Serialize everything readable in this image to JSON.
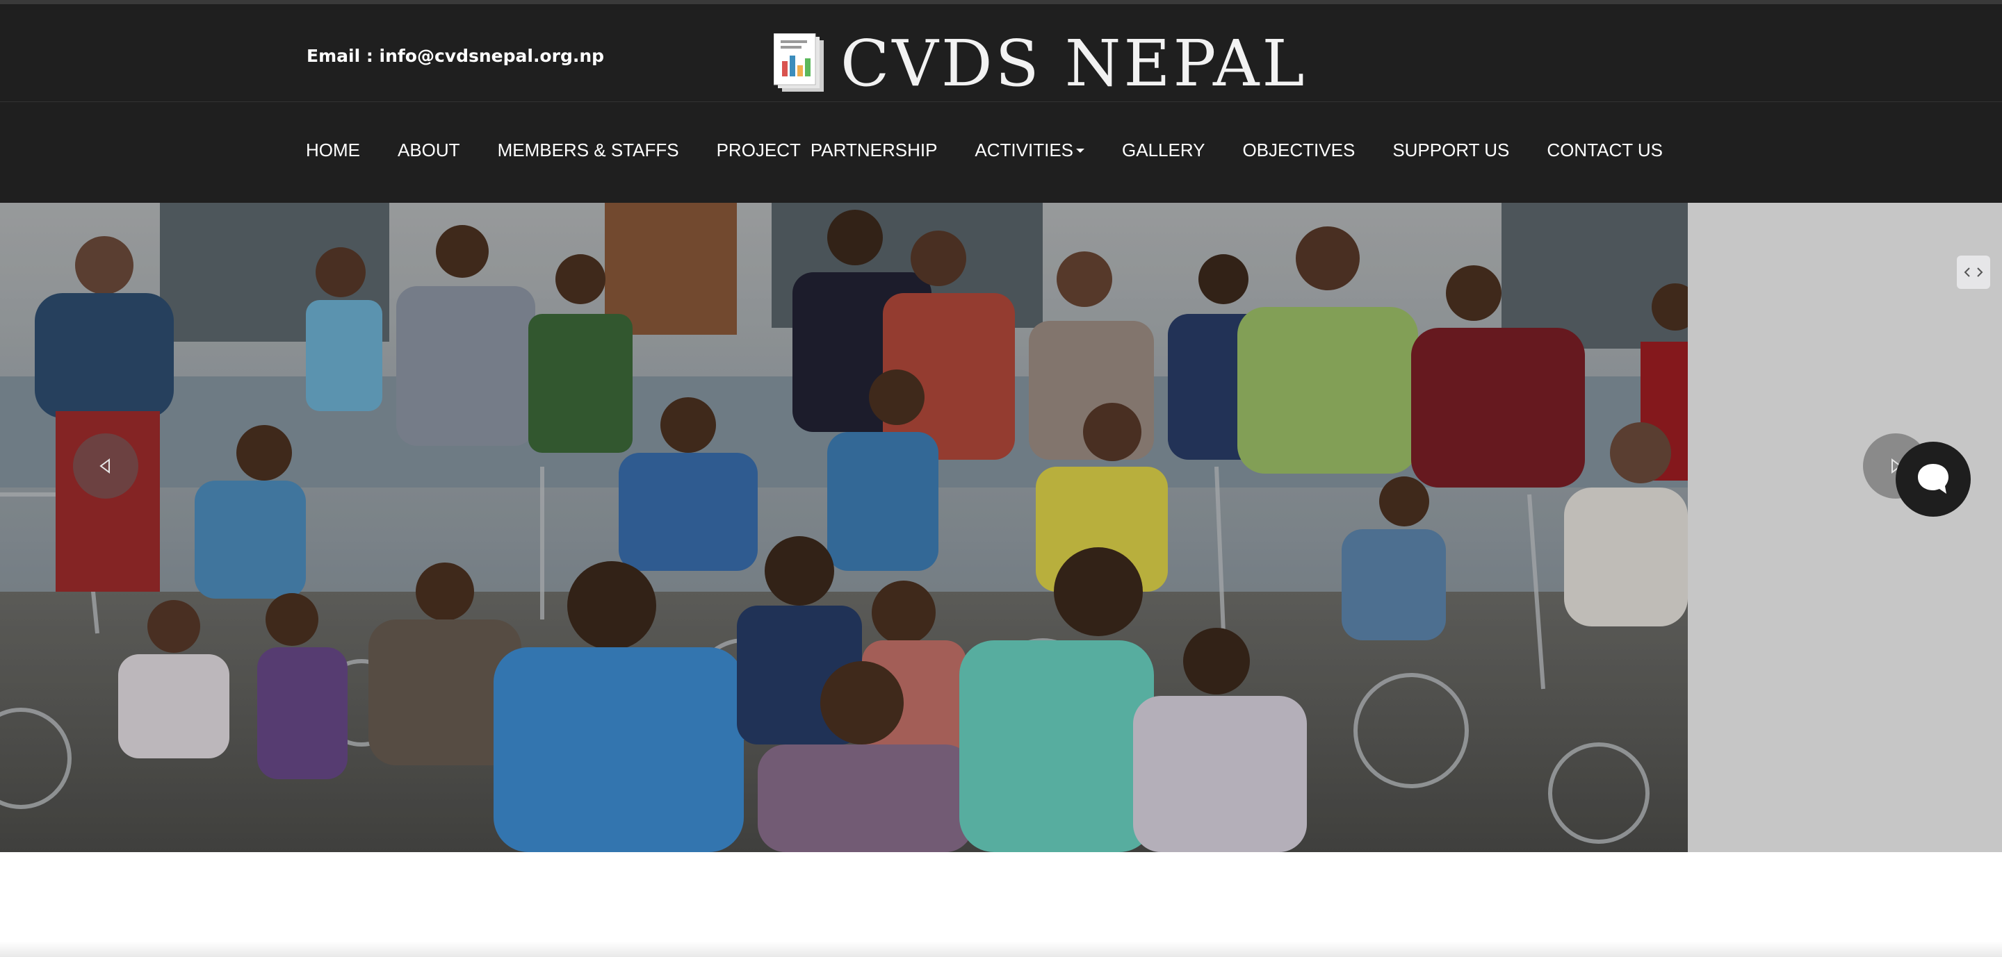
{
  "header": {
    "email_label": "Email : info@cvdsnepal.org.np",
    "logo_text": "CVDS NEPAL"
  },
  "nav": {
    "items": [
      {
        "label": "HOME"
      },
      {
        "label": "ABOUT"
      },
      {
        "label": "MEMBERS & STAFFS"
      },
      {
        "label": "PROJECT  PARTNERSHIP"
      },
      {
        "label": "ACTIVITIES",
        "has_dropdown": true
      },
      {
        "label": "GALLERY"
      },
      {
        "label": "OBJECTIVES"
      },
      {
        "label": "SUPPORT US"
      },
      {
        "label": "CONTACT US"
      }
    ]
  },
  "hero": {
    "icons": {
      "prev": "chevron-left-icon",
      "next": "chevron-right-icon",
      "chat": "chat-bubble-icon"
    }
  },
  "colors": {
    "header_bg": "#1f1f1f",
    "hero_side_bg": "#c6c6c6",
    "chat_bg": "#1e1e1e"
  }
}
